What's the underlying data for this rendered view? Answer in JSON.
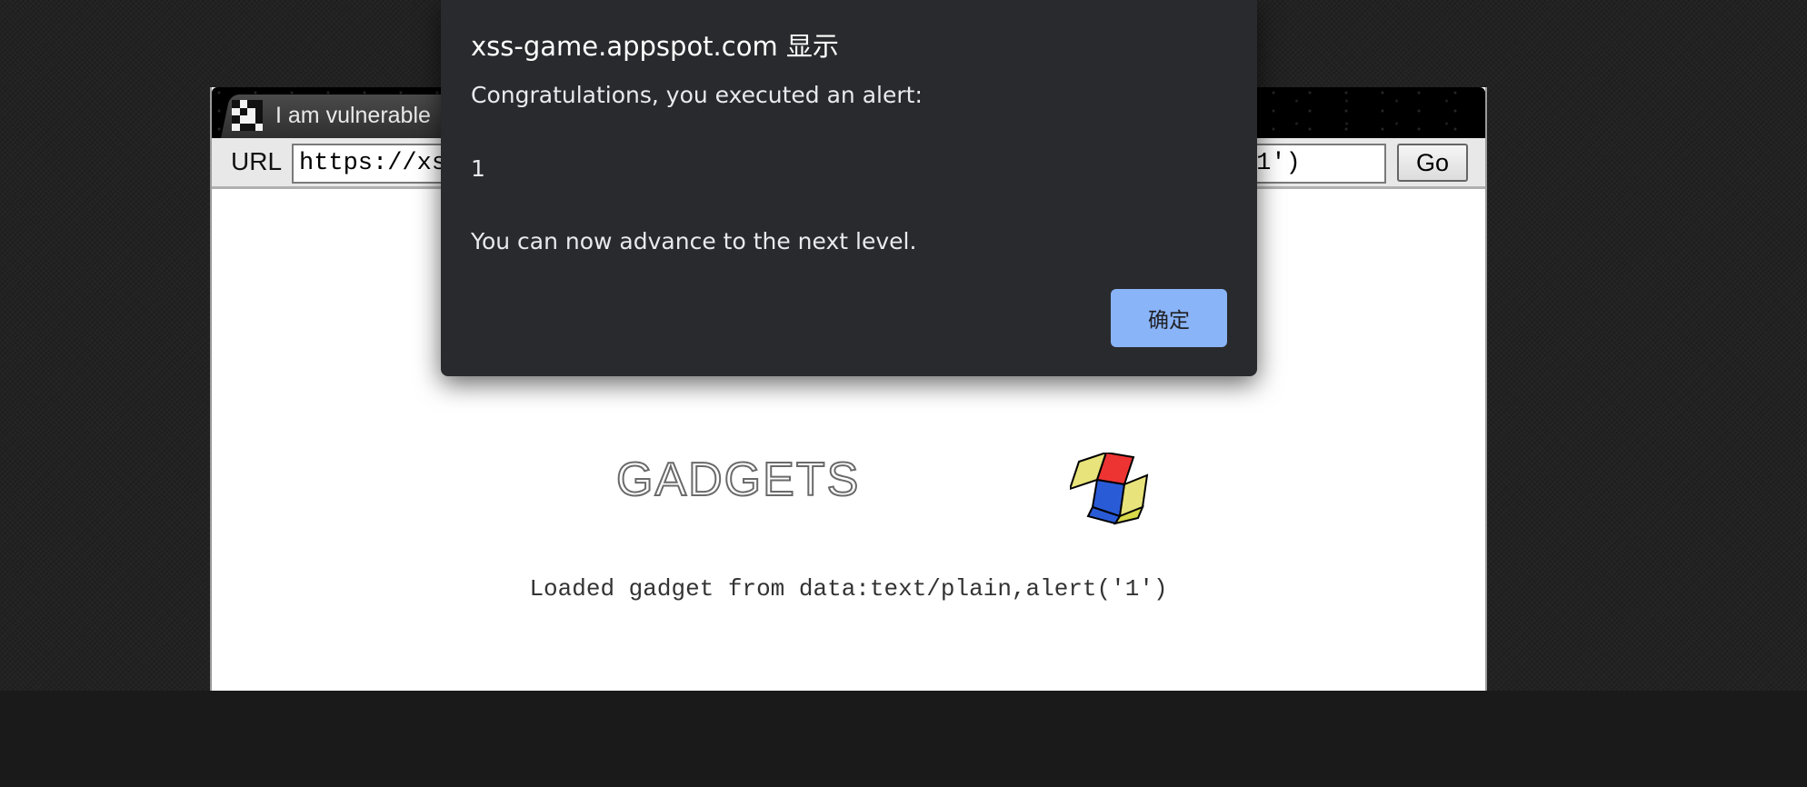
{
  "browser": {
    "tab_title": "I am vulnerable",
    "url_label": "URL",
    "url_value": "https://xss-game.appspot.com/level6/frame#data:text/plain,alert('1')",
    "go_label": "Go"
  },
  "content": {
    "logo_text": "GADGETS",
    "loaded_message": "Loaded gadget from data:text/plain,alert('1')"
  },
  "dialog": {
    "title": "xss-game.appspot.com 显示",
    "message": "Congratulations, you executed an alert:",
    "value": "1",
    "advance_text": "You can now advance to the next level.",
    "ok_label": "确定",
    "ok_color": "#8ab4f8"
  }
}
